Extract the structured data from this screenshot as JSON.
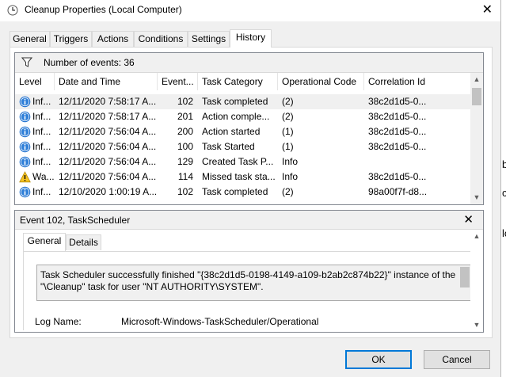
{
  "window": {
    "title": "Cleanup Properties (Local Computer)",
    "close_glyph": "✕"
  },
  "tabs": [
    {
      "label": "General",
      "active": false
    },
    {
      "label": "Triggers",
      "active": false
    },
    {
      "label": "Actions",
      "active": false
    },
    {
      "label": "Conditions",
      "active": false
    },
    {
      "label": "Settings",
      "active": false
    },
    {
      "label": "History",
      "active": true
    }
  ],
  "history": {
    "event_count_text": "Number of events: 36",
    "columns": [
      "Level",
      "Date and Time",
      "Event...",
      "Task Category",
      "Operational Code",
      "Correlation Id"
    ],
    "rows": [
      {
        "level": "info",
        "level_text": "Inf...",
        "datetime": "12/11/2020 7:58:17 A...",
        "event_id": "102",
        "category": "Task completed",
        "opcode": "(2)",
        "correlation": "38c2d1d5-0...",
        "selected": true
      },
      {
        "level": "info",
        "level_text": "Inf...",
        "datetime": "12/11/2020 7:58:17 A...",
        "event_id": "201",
        "category": "Action comple...",
        "opcode": "(2)",
        "correlation": "38c2d1d5-0...",
        "selected": false
      },
      {
        "level": "info",
        "level_text": "Inf...",
        "datetime": "12/11/2020 7:56:04 A...",
        "event_id": "200",
        "category": "Action started",
        "opcode": "(1)",
        "correlation": "38c2d1d5-0...",
        "selected": false
      },
      {
        "level": "info",
        "level_text": "Inf...",
        "datetime": "12/11/2020 7:56:04 A...",
        "event_id": "100",
        "category": "Task Started",
        "opcode": "(1)",
        "correlation": "38c2d1d5-0...",
        "selected": false
      },
      {
        "level": "info",
        "level_text": "Inf...",
        "datetime": "12/11/2020 7:56:04 A...",
        "event_id": "129",
        "category": "Created Task P...",
        "opcode": "Info",
        "correlation": "",
        "selected": false
      },
      {
        "level": "warning",
        "level_text": "Wa...",
        "datetime": "12/11/2020 7:56:04 A...",
        "event_id": "114",
        "category": "Missed task sta...",
        "opcode": "Info",
        "correlation": "38c2d1d5-0...",
        "selected": false
      },
      {
        "level": "info",
        "level_text": "Inf...",
        "datetime": "12/10/2020 1:00:19 A...",
        "event_id": "102",
        "category": "Task completed",
        "opcode": "(2)",
        "correlation": "98a00f7f-d8...",
        "selected": false
      }
    ]
  },
  "details": {
    "title": "Event 102, TaskScheduler",
    "close_glyph": "✕",
    "tabs": [
      {
        "label": "General",
        "active": true
      },
      {
        "label": "Details",
        "active": false
      }
    ],
    "description": "Task Scheduler successfully finished \"{38c2d1d5-0198-4149-a109-b2ab2c874b22}\" instance of the \"\\Cleanup\" task for user \"NT AUTHORITY\\SYSTEM\".",
    "log_name_label": "Log Name:",
    "log_name_value": "Microsoft-Windows-TaskScheduler/Operational"
  },
  "buttons": {
    "ok": "OK",
    "cancel": "Cancel"
  },
  "background_fragments": [
    "b",
    "c",
    "lo"
  ],
  "colors": {
    "accent": "#0078d7",
    "info_icon": "#1c6fcf",
    "warning_icon": "#f7c423"
  }
}
